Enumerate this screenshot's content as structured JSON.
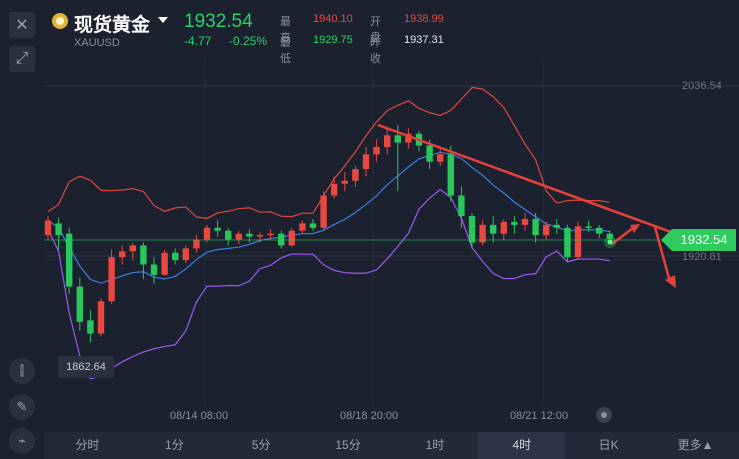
{
  "header": {
    "name": "现货黄金",
    "symbol": "XAUUSD",
    "price": "1932.54",
    "change": "-4.77",
    "change_pct": "-0.25%",
    "high_label": "最高",
    "high": "1940.10",
    "open_label": "开盘",
    "open": "1938.99",
    "low_label": "最低",
    "low": "1929.75",
    "prev_label": "昨收",
    "prev": "1937.31"
  },
  "chart": {
    "price_tag": "1932.54",
    "y_top_label": "2036.54",
    "y_bottom_label": "1920.81",
    "min_tag": "1862.64",
    "x_labels": [
      "08/14 08:00",
      "08/18 20:00",
      "08/21 12:00"
    ]
  },
  "timeframes": [
    "分时",
    "1分",
    "5分",
    "15分",
    "1时",
    "4时",
    "日K",
    "更多▲"
  ],
  "active_timeframe": "4时",
  "colors": {
    "up": "#e8483f",
    "down": "#27c75b",
    "price_line": "#2ecc5e",
    "mid_band": "#3d7fe0",
    "upper_band": "#e0473c",
    "lower_band": "#9a5cf0"
  },
  "chart_data": {
    "type": "candlestick",
    "candles": [
      [
        1935,
        1948,
        1945,
        1932
      ],
      [
        1943,
        1947,
        1935,
        1925
      ],
      [
        1936,
        1940,
        1900,
        1895
      ],
      [
        1900,
        1906,
        1876,
        1870
      ],
      [
        1877,
        1884,
        1868,
        1862
      ],
      [
        1868,
        1892,
        1890,
        1866
      ],
      [
        1890,
        1925,
        1920,
        1888
      ],
      [
        1920,
        1928,
        1924,
        1915
      ],
      [
        1924,
        1930,
        1928,
        1918
      ],
      [
        1928,
        1930,
        1915,
        1905
      ],
      [
        1915,
        1920,
        1908,
        1902
      ],
      [
        1908,
        1925,
        1923,
        1907
      ],
      [
        1923,
        1926,
        1918,
        1915
      ],
      [
        1918,
        1928,
        1926,
        1916
      ],
      [
        1926,
        1935,
        1932,
        1923
      ],
      [
        1932,
        1942,
        1940,
        1930
      ],
      [
        1940,
        1945,
        1938,
        1934
      ],
      [
        1938,
        1940,
        1932,
        1928
      ],
      [
        1932,
        1938,
        1936,
        1929
      ],
      [
        1936,
        1939,
        1934,
        1930
      ],
      [
        1934,
        1937,
        1935,
        1930
      ],
      [
        1935,
        1939,
        1936,
        1932
      ],
      [
        1936,
        1938,
        1928,
        1926
      ],
      [
        1928,
        1940,
        1938,
        1927
      ],
      [
        1938,
        1945,
        1943,
        1936
      ],
      [
        1943,
        1946,
        1940,
        1938
      ],
      [
        1940,
        1965,
        1962,
        1938
      ],
      [
        1962,
        1975,
        1970,
        1960
      ],
      [
        1970,
        1978,
        1972,
        1965
      ],
      [
        1972,
        1982,
        1980,
        1968
      ],
      [
        1980,
        1995,
        1990,
        1975
      ],
      [
        1990,
        2000,
        1995,
        1985
      ],
      [
        1995,
        2008,
        2003,
        1990
      ],
      [
        2003,
        2010,
        1998,
        1965
      ],
      [
        1998,
        2008,
        2004,
        1994
      ],
      [
        2004,
        2006,
        1996,
        1992
      ],
      [
        1996,
        2000,
        1985,
        1980
      ],
      [
        1985,
        1994,
        1990,
        1982
      ],
      [
        1990,
        1996,
        1962,
        1958
      ],
      [
        1962,
        1968,
        1948,
        1940
      ],
      [
        1948,
        1950,
        1930,
        1926
      ],
      [
        1930,
        1945,
        1942,
        1928
      ],
      [
        1942,
        1948,
        1936,
        1930
      ],
      [
        1936,
        1946,
        1944,
        1932
      ],
      [
        1944,
        1948,
        1942,
        1936
      ],
      [
        1942,
        1950,
        1946,
        1938
      ],
      [
        1946,
        1950,
        1935,
        1930
      ],
      [
        1935,
        1944,
        1942,
        1932
      ],
      [
        1942,
        1946,
        1940,
        1936
      ],
      [
        1940,
        1942,
        1920,
        1917
      ],
      [
        1920,
        1944,
        1941,
        1918
      ],
      [
        1941,
        1945,
        1940,
        1937
      ],
      [
        1940,
        1942,
        1936,
        1933
      ],
      [
        1936,
        1938,
        1932.5,
        1929.8
      ]
    ],
    "y_ticks": [
      "2036.54",
      "1920.81"
    ],
    "x_ticks": [
      "08/14 08:00",
      "08/18 20:00",
      "08/21 12:00"
    ]
  }
}
